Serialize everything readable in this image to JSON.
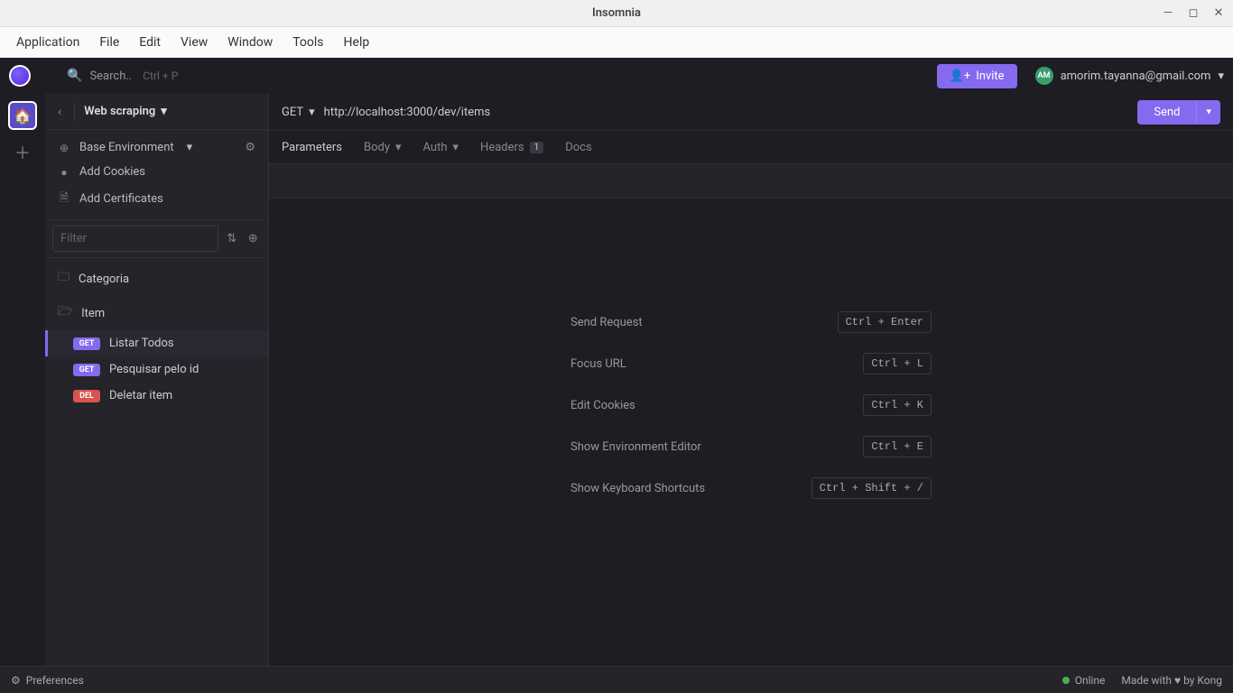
{
  "window": {
    "title": "Insomnia"
  },
  "menu": {
    "items": [
      "Application",
      "File",
      "Edit",
      "View",
      "Window",
      "Tools",
      "Help"
    ]
  },
  "toolbar": {
    "search_placeholder": "Search..",
    "search_hint": "Ctrl + P",
    "invite_label": "Invite",
    "user_initials": "AM",
    "user_email": "amorim.tayanna@gmail.com"
  },
  "sidebar": {
    "workspace": "Web scraping",
    "env_label": "Base Environment",
    "cookies_label": "Add Cookies",
    "certs_label": "Add Certificates",
    "filter_placeholder": "Filter",
    "folders": [
      {
        "name": "Categoria",
        "open": false
      },
      {
        "name": "Item",
        "open": true
      }
    ],
    "requests": [
      {
        "method": "GET",
        "name": "Listar Todos",
        "active": true
      },
      {
        "method": "GET",
        "name": "Pesquisar pelo id",
        "active": false
      },
      {
        "method": "DEL",
        "name": "Deletar item",
        "active": false
      }
    ]
  },
  "request": {
    "method": "GET",
    "url": "http://localhost:3000/dev/items",
    "send_label": "Send"
  },
  "tabs": {
    "parameters": "Parameters",
    "body": "Body",
    "auth": "Auth",
    "headers": "Headers",
    "headers_count": "1",
    "docs": "Docs"
  },
  "shortcuts": [
    {
      "label": "Send Request",
      "keys": "Ctrl + Enter"
    },
    {
      "label": "Focus URL",
      "keys": "Ctrl + L"
    },
    {
      "label": "Edit Cookies",
      "keys": "Ctrl + K"
    },
    {
      "label": "Show Environment Editor",
      "keys": "Ctrl + E"
    },
    {
      "label": "Show Keyboard Shortcuts",
      "keys": "Ctrl + Shift + /"
    }
  ],
  "status": {
    "preferences": "Preferences",
    "online": "Online",
    "credit": "Made with ♥ by Kong"
  }
}
